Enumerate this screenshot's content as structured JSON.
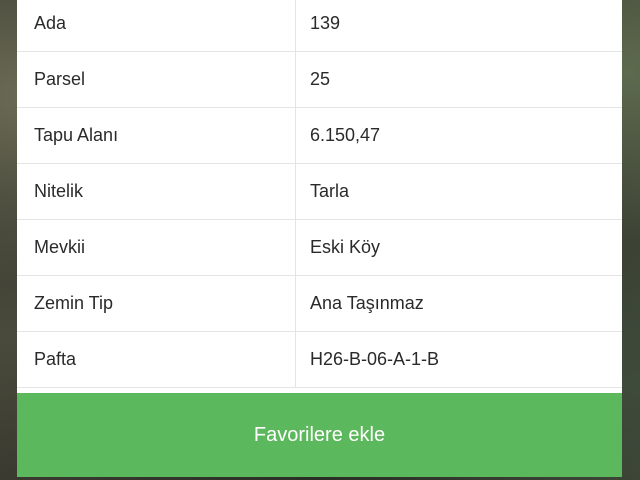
{
  "details": {
    "rows": [
      {
        "label": "Ada",
        "value": "139"
      },
      {
        "label": "Parsel",
        "value": "25"
      },
      {
        "label": "Tapu Alanı",
        "value": "6.150,47"
      },
      {
        "label": "Nitelik",
        "value": "Tarla"
      },
      {
        "label": "Mevkii",
        "value": "Eski Köy"
      },
      {
        "label": "Zemin Tip",
        "value": "Ana Taşınmaz"
      },
      {
        "label": "Pafta",
        "value": "H26-B-06-A-1-B"
      }
    ]
  },
  "actions": {
    "favorite_label": "Favorilere ekle"
  },
  "colors": {
    "button_green": "#5cb85c",
    "divider": "#e4e4e4",
    "text": "#2a2a2a"
  }
}
